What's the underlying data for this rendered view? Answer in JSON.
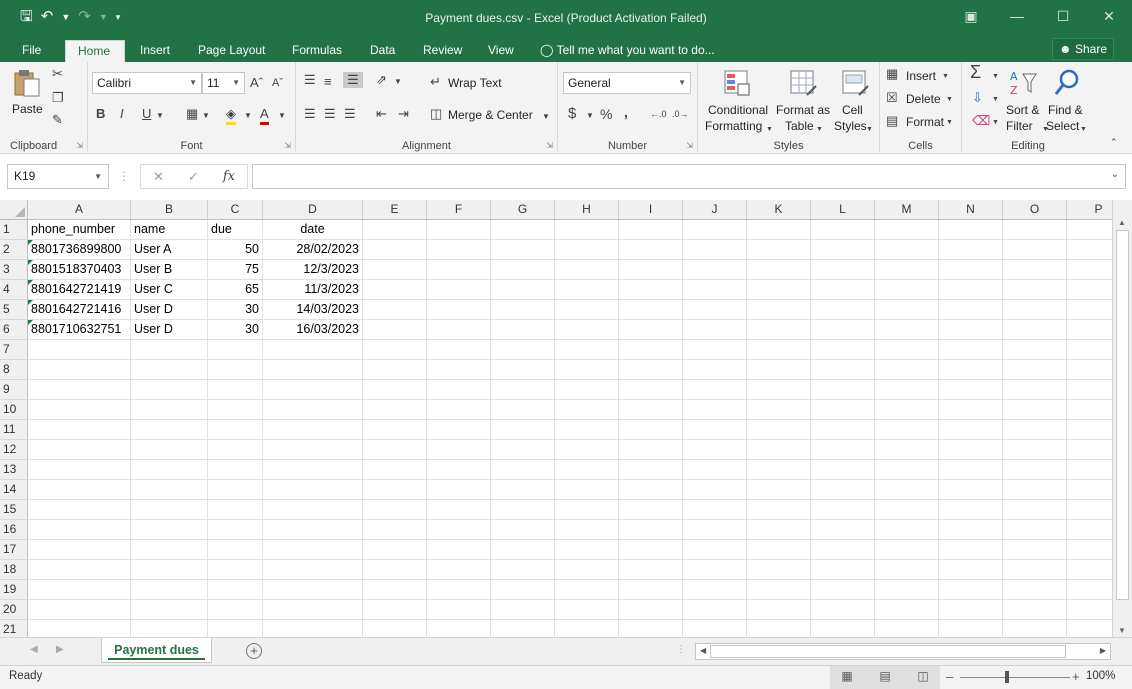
{
  "window": {
    "title": "Payment dues.csv - Excel (Product Activation Failed)",
    "qat_icons": [
      "save-icon",
      "undo-icon",
      "redo-icon",
      "customize-qat-icon"
    ]
  },
  "ribbon_tabs": [
    "File",
    "Home",
    "Insert",
    "Page Layout",
    "Formulas",
    "Data",
    "Review",
    "View"
  ],
  "active_tab": "Home",
  "tell_me": "Tell me what you want to do...",
  "share_label": "Share",
  "ribbon": {
    "clipboard": {
      "paste": "Paste",
      "group": "Clipboard"
    },
    "font": {
      "name": "Calibri",
      "size": "11",
      "bold": "B",
      "italic": "I",
      "underline": "U",
      "group": "Font"
    },
    "alignment": {
      "wrap_text": "Wrap Text",
      "merge_center": "Merge & Center",
      "group": "Alignment"
    },
    "number": {
      "format": "General",
      "currency": "$",
      "percent": "%",
      "comma": ",",
      "group": "Number"
    },
    "styles": {
      "conditional_1": "Conditional",
      "conditional_2": "Formatting",
      "format_as_1": "Format as",
      "format_as_2": "Table",
      "cell_1": "Cell",
      "cell_2": "Styles",
      "group": "Styles"
    },
    "cells": {
      "insert": "Insert",
      "delete": "Delete",
      "format": "Format",
      "group": "Cells"
    },
    "editing": {
      "sort_1": "Sort &",
      "sort_2": "Filter",
      "find_1": "Find &",
      "find_2": "Select",
      "group": "Editing"
    }
  },
  "formula_bar": {
    "name_box": "K19",
    "formula": "",
    "fx": "fx"
  },
  "columns": [
    "A",
    "B",
    "C",
    "D",
    "E",
    "F",
    "G",
    "H",
    "I",
    "J",
    "K",
    "L",
    "M",
    "N",
    "O",
    "P"
  ],
  "rows": [
    "1",
    "2",
    "3",
    "4",
    "5",
    "6",
    "7",
    "8",
    "9",
    "10",
    "11",
    "12",
    "13",
    "14",
    "15",
    "16",
    "17",
    "18",
    "19",
    "20",
    "21"
  ],
  "sheet": {
    "headers": [
      "phone_number",
      "name",
      "due",
      "date"
    ],
    "data": [
      [
        "8801736899800",
        "User A",
        "50",
        "28/02/2023"
      ],
      [
        "8801518370403",
        "User B",
        "75",
        "12/3/2023"
      ],
      [
        "8801642721419",
        "User C",
        "65",
        "11/3/2023"
      ],
      [
        "8801642721416",
        "User D",
        "30",
        "14/03/2023"
      ],
      [
        "8801710632751",
        "User D",
        "30",
        "16/03/2023"
      ]
    ]
  },
  "sheet_tab": "Payment dues",
  "status": {
    "ready": "Ready",
    "zoom": "100%"
  }
}
